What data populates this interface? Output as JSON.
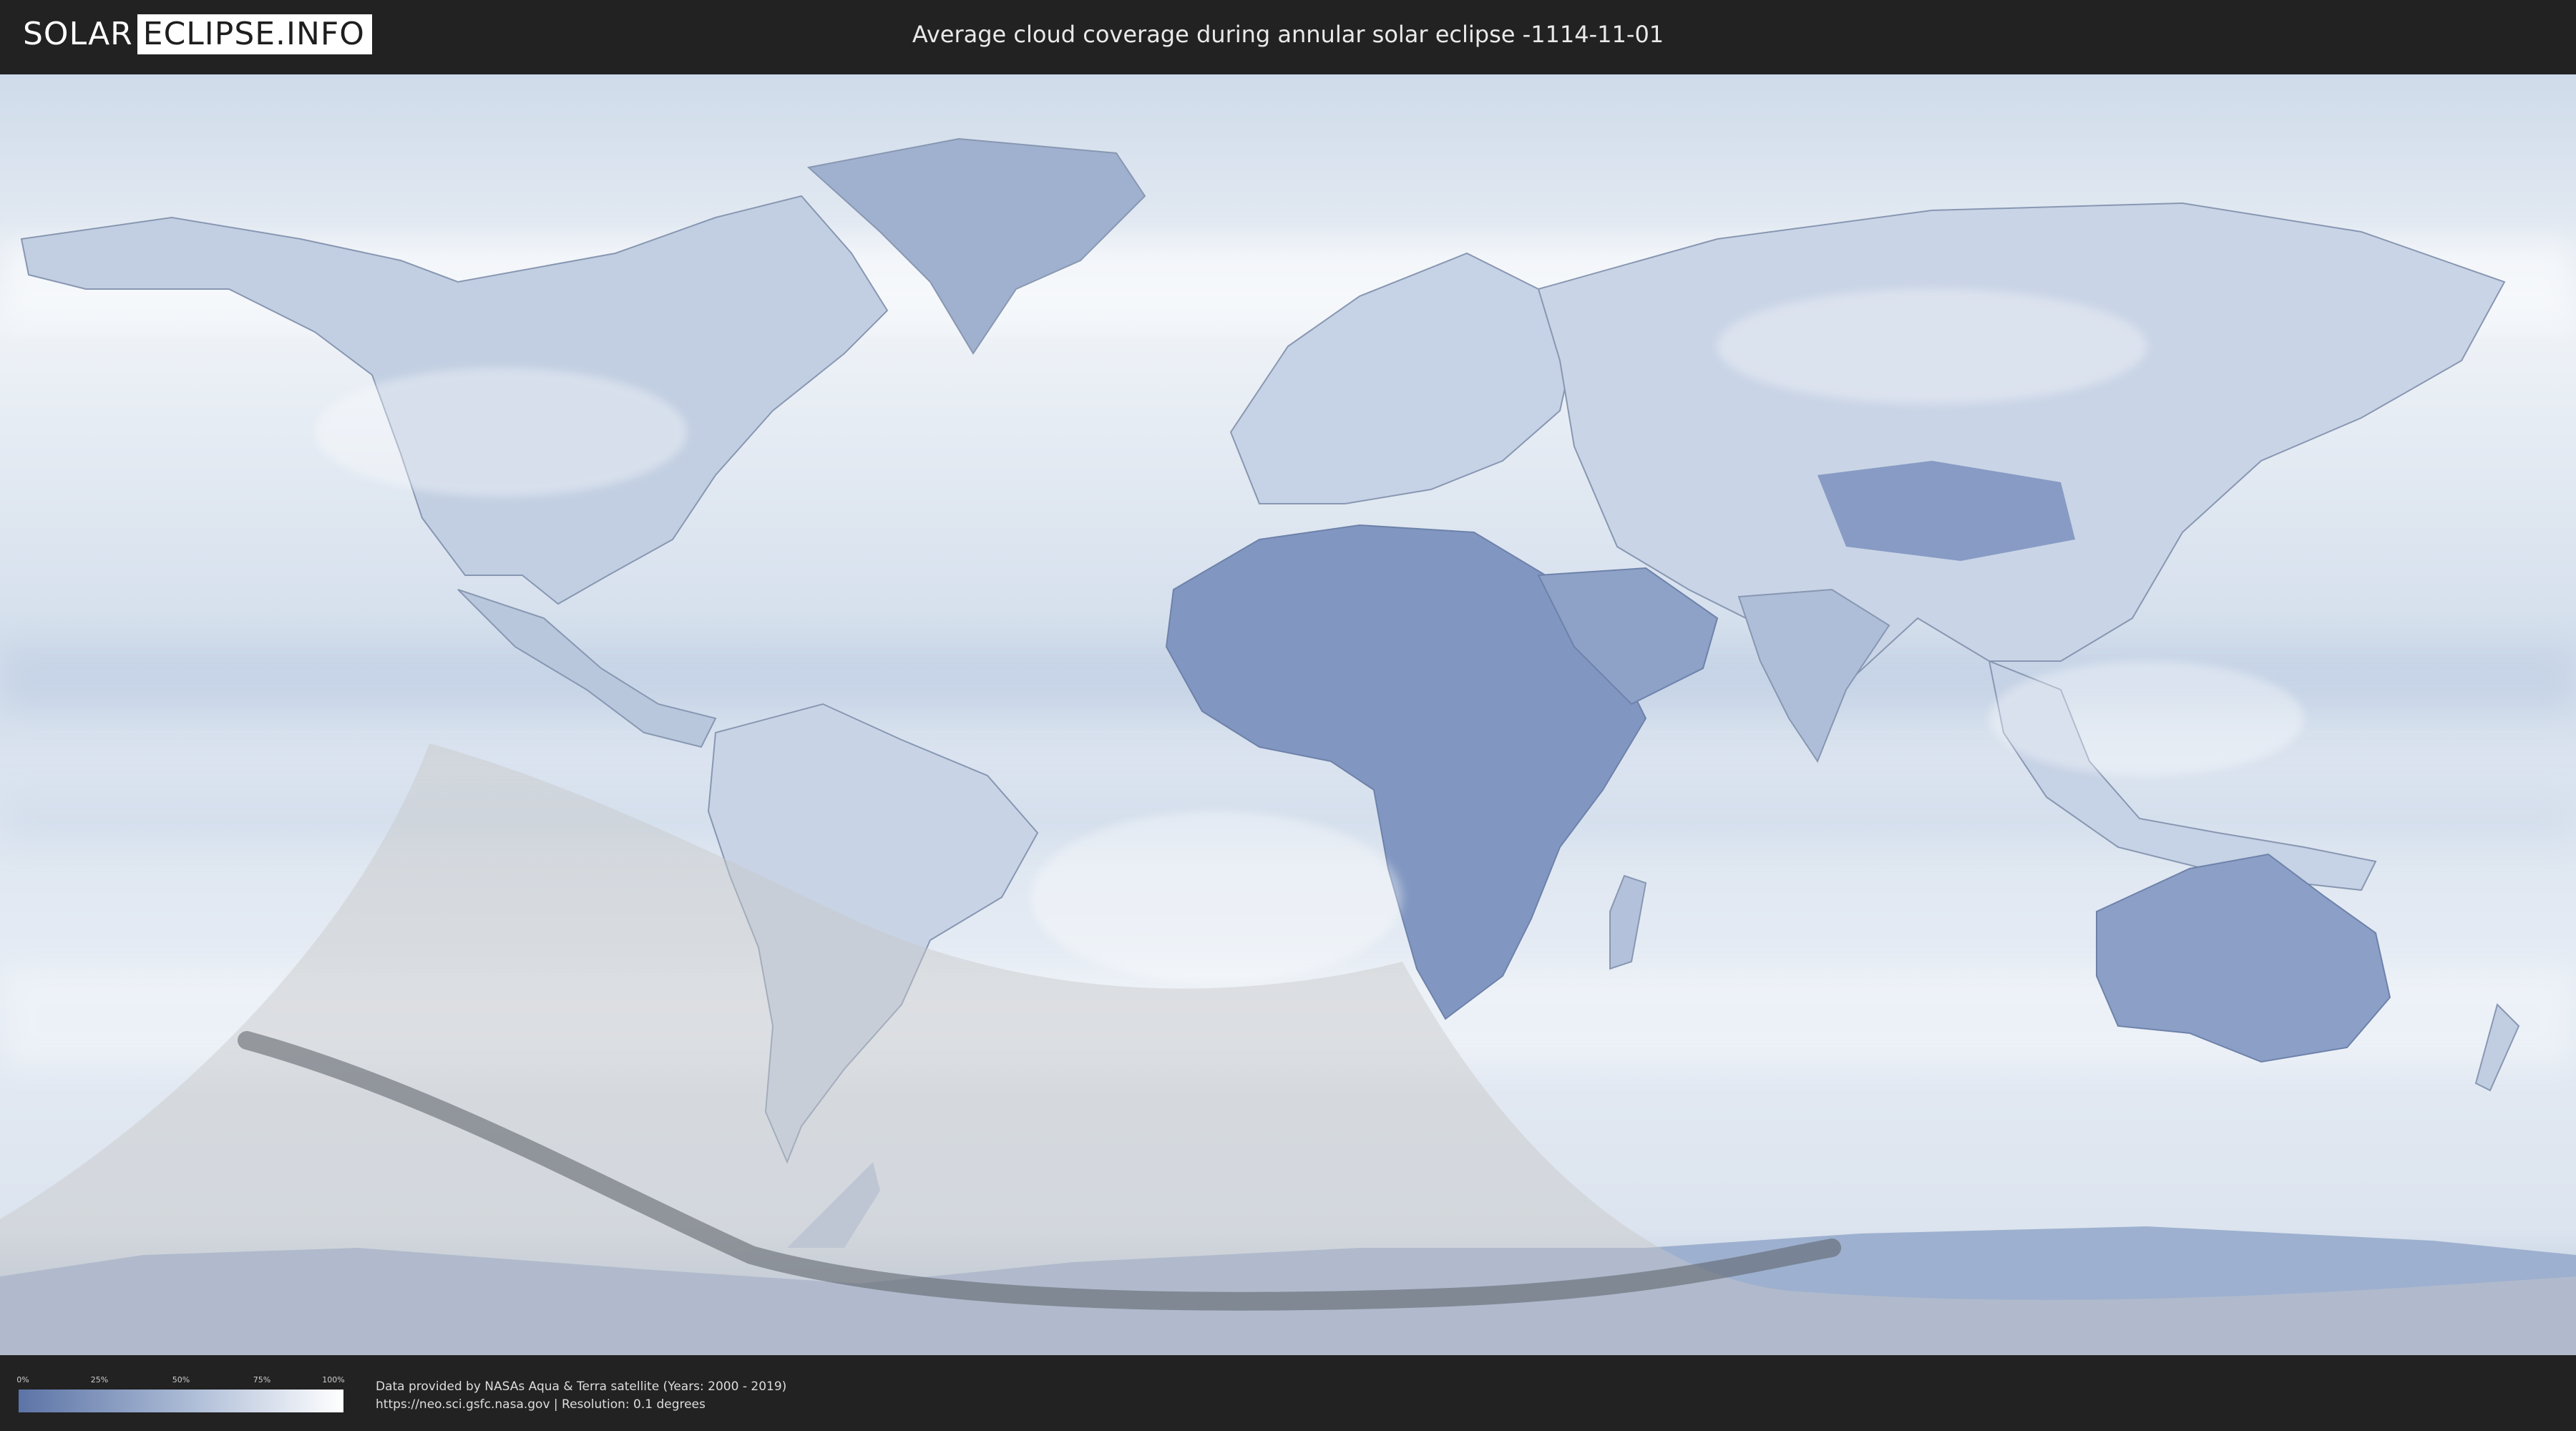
{
  "header": {
    "logo_part_a": "SOLAR",
    "logo_part_b": "ECLIPSE.INFO",
    "title": "Average cloud coverage during annular solar eclipse -1114-11-01"
  },
  "legend": {
    "ticks": [
      "0%",
      "25%",
      "50%",
      "75%",
      "100%"
    ],
    "color_low": "#5c74a6",
    "color_high": "#ffffff"
  },
  "credits": {
    "line1": "Data provided by NASAs Aqua & Terra satellite (Years: 2000 - 2019)",
    "line2": "https://neo.sci.gsfc.nasa.gov | Resolution: 0.1 degrees"
  },
  "colors": {
    "background": "#222222",
    "ocean_cloud": "#dfe7f1",
    "land_clear": "#6a82b2",
    "penumbra": "#c8c8c8",
    "annular_path": "#5a5e66"
  }
}
